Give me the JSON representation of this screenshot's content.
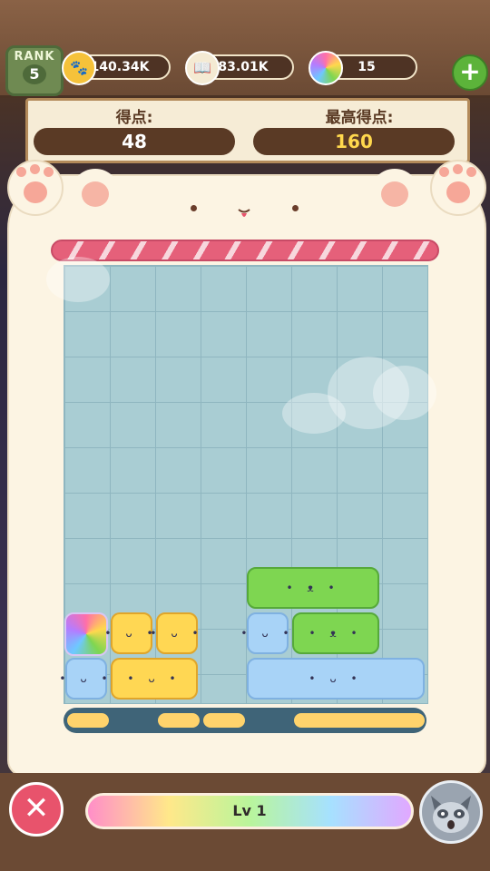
{
  "header": {
    "rank_label": "RANK",
    "rank_value": "5",
    "coins": "140.34K",
    "books": "83.01K",
    "candies": "15",
    "add_icon": "plus-icon"
  },
  "scoreboard": {
    "score_label": "得点:",
    "score_value": "48",
    "best_label": "最高得点:",
    "best_value": "160"
  },
  "bottom": {
    "close_icon": "close-icon",
    "level_label": "Lv 1"
  },
  "colors": {
    "green_block": "#7ed651",
    "blue_block": "#a8d3f7",
    "yellow_block": "#ffd753",
    "candy_stripe": "#e5607a",
    "best_score": "#ffd84d"
  }
}
